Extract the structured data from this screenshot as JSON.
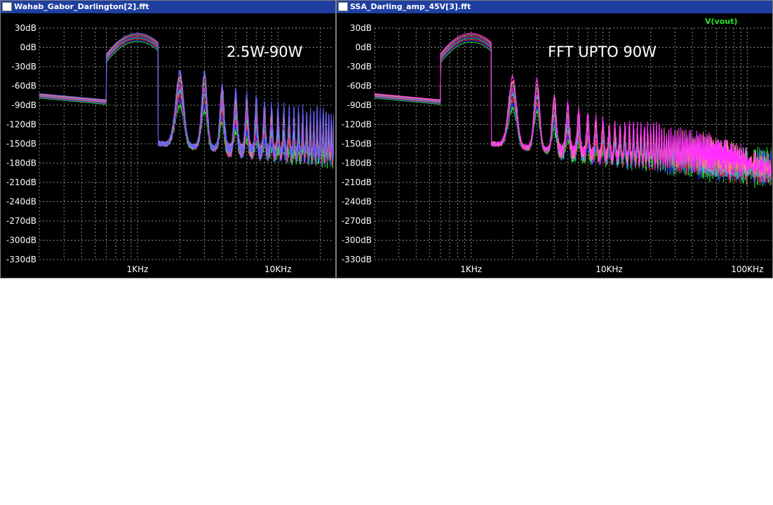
{
  "panels": [
    {
      "title": "Wahab_Gabor_Darlington[2].fft",
      "annotation": "2.5W-90W",
      "legend": "",
      "chart_data": {
        "type": "line",
        "scale_x": "log",
        "xlim": [
          200,
          25000
        ],
        "ylim": [
          -330,
          30
        ],
        "y_ticks": [
          30,
          0,
          -30,
          -60,
          -90,
          -120,
          -150,
          -180,
          -210,
          -240,
          -270,
          -300,
          -330
        ],
        "y_tick_labels": [
          "30dB",
          "0dB",
          "-30dB",
          "-60dB",
          "-90dB",
          "-120dB",
          "-150dB",
          "-180dB",
          "-210dB",
          "-240dB",
          "-270dB",
          "-300dB",
          "-330dB"
        ],
        "x_ticks": [
          1000,
          10000
        ],
        "x_tick_labels": [
          "1KHz",
          "10KHz"
        ],
        "grid": true,
        "fundamental_band_hz": [
          600,
          1400
        ],
        "fundamental_peak_db_top": 22,
        "fundamental_peak_db_bottom": 9,
        "harmonic_top_db": [
          -38,
          -38,
          -60,
          -70,
          -75,
          -80,
          -85,
          -90,
          -92,
          -95,
          -95,
          -95,
          -97,
          -98
        ],
        "harmonic_bottom_db": [
          -90,
          -100,
          -115,
          -125,
          -140,
          -145,
          -150,
          -155
        ],
        "noise_floor_db": [
          -150,
          -180
        ],
        "series": [
          {
            "color": "#22e622"
          },
          {
            "color": "#1a2bff"
          },
          {
            "color": "#ff2222"
          },
          {
            "color": "#20d0d0"
          },
          {
            "color": "#e020e0"
          },
          {
            "color": "#808080"
          },
          {
            "color": "#ff8080"
          },
          {
            "color": "#6060ff"
          }
        ]
      }
    },
    {
      "title": "SSA_Darling_amp_45V[3].fft",
      "annotation": "FFT UPTO 90W",
      "legend": "V(vout)",
      "chart_data": {
        "type": "line",
        "scale_x": "log",
        "xlim": [
          200,
          150000
        ],
        "ylim": [
          -330,
          30
        ],
        "y_ticks": [
          30,
          0,
          -30,
          -60,
          -90,
          -120,
          -150,
          -180,
          -210,
          -240,
          -270,
          -300,
          -330
        ],
        "y_tick_labels": [
          "30dB",
          "0dB",
          "-30dB",
          "-60dB",
          "-90dB",
          "-120dB",
          "-150dB",
          "-180dB",
          "-210dB",
          "-240dB",
          "-270dB",
          "-300dB",
          "-330dB"
        ],
        "x_ticks": [
          1000,
          10000,
          100000
        ],
        "x_tick_labels": [
          "1KHz",
          "10KHz",
          "100KHz"
        ],
        "grid": true,
        "fundamental_band_hz": [
          600,
          1400
        ],
        "fundamental_peak_db_top": 22,
        "fundamental_peak_db_bottom": 8,
        "harmonic_top_db": [
          -45,
          -50,
          -75,
          -90,
          -100,
          -105,
          -110,
          -115,
          -118,
          -120,
          -122
        ],
        "harmonic_bottom_db": [
          -95,
          -100,
          -125,
          -140,
          -150,
          -155
        ],
        "noise_floor_db": [
          -150,
          -215
        ],
        "series": [
          {
            "color": "#22e622"
          },
          {
            "color": "#1a2bff"
          },
          {
            "color": "#ff2222"
          },
          {
            "color": "#20d0d0"
          },
          {
            "color": "#e020e0"
          },
          {
            "color": "#808080"
          },
          {
            "color": "#ff8080"
          },
          {
            "color": "#ff30ff"
          }
        ]
      }
    }
  ]
}
